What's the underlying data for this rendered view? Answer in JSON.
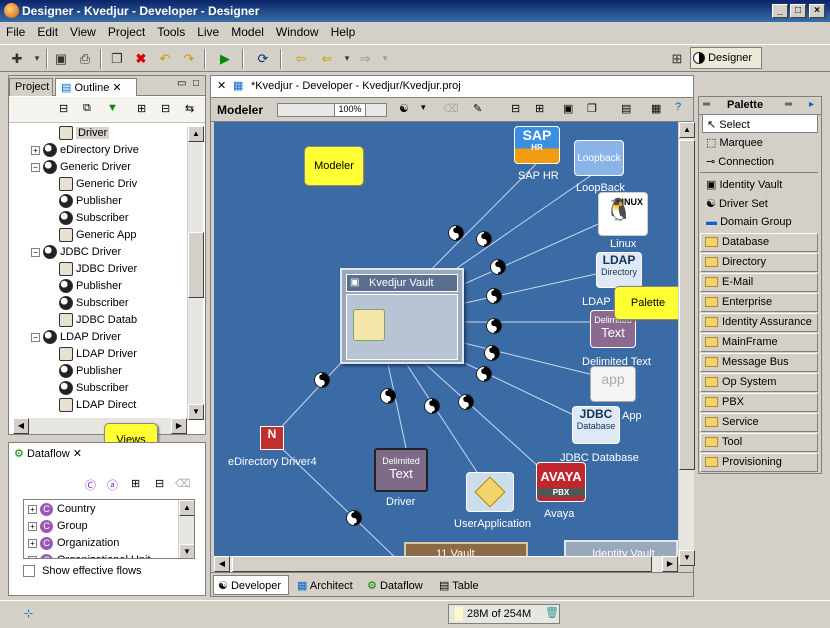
{
  "window": {
    "title": "Designer - Kvedjur - Developer - Designer"
  },
  "menu": [
    "File",
    "Edit",
    "View",
    "Project",
    "Tools",
    "Live",
    "Model",
    "Window",
    "Help"
  ],
  "perspective": {
    "label": "Designer"
  },
  "left_panel": {
    "tabs": [
      "Project",
      "Outline"
    ],
    "tree": [
      {
        "label": "Driver",
        "depth": 3,
        "icon": "driver-icon",
        "selected": true
      },
      {
        "label": "eDirectory Drive",
        "depth": 2,
        "icon": "yinyang-icon",
        "expander": "+"
      },
      {
        "label": "Generic Driver",
        "depth": 2,
        "icon": "yinyang-icon",
        "expander": "-"
      },
      {
        "label": "Generic Driv",
        "depth": 3,
        "icon": "filter-icon"
      },
      {
        "label": "Publisher",
        "depth": 3,
        "icon": "publisher-icon"
      },
      {
        "label": "Subscriber",
        "depth": 3,
        "icon": "subscriber-icon"
      },
      {
        "label": "Generic App",
        "depth": 3,
        "icon": "app-icon"
      },
      {
        "label": "JDBC Driver",
        "depth": 2,
        "icon": "yinyang-icon",
        "expander": "-"
      },
      {
        "label": "JDBC Driver",
        "depth": 3,
        "icon": "filter-icon"
      },
      {
        "label": "Publisher",
        "depth": 3,
        "icon": "publisher-icon"
      },
      {
        "label": "Subscriber",
        "depth": 3,
        "icon": "subscriber-icon"
      },
      {
        "label": "JDBC Datab",
        "depth": 3,
        "icon": "database-icon"
      },
      {
        "label": "LDAP Driver",
        "depth": 2,
        "icon": "yinyang-icon",
        "expander": "-"
      },
      {
        "label": "LDAP Driver",
        "depth": 3,
        "icon": "filter-icon"
      },
      {
        "label": "Publisher",
        "depth": 3,
        "icon": "publisher-icon"
      },
      {
        "label": "Subscriber",
        "depth": 3,
        "icon": "subscriber-icon"
      },
      {
        "label": "LDAP Direct",
        "depth": 3,
        "icon": "ldap-icon"
      }
    ]
  },
  "dataflow": {
    "tab": "Dataflow",
    "items": [
      "Country",
      "Group",
      "Organization",
      "Organizational Unit"
    ],
    "show_effective_flows": "Show effective flows"
  },
  "editor": {
    "tab": "*Kvedjur - Developer - Kvedjur/Kvedjur.proj",
    "toolbar_label": "Modeler",
    "zoom": "100%",
    "bottom_tabs": [
      "Developer",
      "Architect",
      "Dataflow",
      "Table"
    ]
  },
  "canvas": {
    "vault_title": "Kvedjur Vault",
    "nodes": {
      "sap": {
        "label": "SAP HR",
        "logo": "SAP",
        "sub": "HR"
      },
      "loopback": {
        "label": "LoopBack",
        "logo": "Loopback"
      },
      "linux": {
        "label": "Linux",
        "logo": "LINUX"
      },
      "ldap": {
        "label": "LDAP D",
        "logo": "LDAP",
        "sub": "Directory"
      },
      "delimited": {
        "label": "Delimited Text",
        "logo": "Delimited",
        "sub": "Text"
      },
      "app": {
        "label": "App",
        "logo": "app"
      },
      "jdbc": {
        "label": "JDBC Database",
        "logo": "JDBC",
        "sub": "Database"
      },
      "avaya": {
        "label": "Avaya",
        "logo": "AVAYA",
        "sub": "PBX"
      },
      "userapp": {
        "label": "UserApplication"
      },
      "driver": {
        "label": "Driver",
        "logo": "Delimited",
        "sub": "Text"
      },
      "edir": {
        "label": "eDirectory Driver4"
      },
      "vault11": {
        "label": "11 Vault"
      },
      "idvault": {
        "label": "Identity Vault"
      }
    },
    "callouts": {
      "modeler": "Modeler",
      "palette": "Palette",
      "views": "Views"
    }
  },
  "palette": {
    "title": "Palette",
    "tools": [
      "Select",
      "Marquee",
      "Connection"
    ],
    "items": [
      "Identity Vault",
      "Driver Set",
      "Domain Group"
    ],
    "drawers": [
      "Database",
      "Directory",
      "E-Mail",
      "Enterprise",
      "Identity Assurance",
      "MainFrame",
      "Message Bus",
      "Op System",
      "PBX",
      "Service",
      "Tool",
      "Provisioning"
    ]
  },
  "status": {
    "memory": "28M of 254M"
  }
}
